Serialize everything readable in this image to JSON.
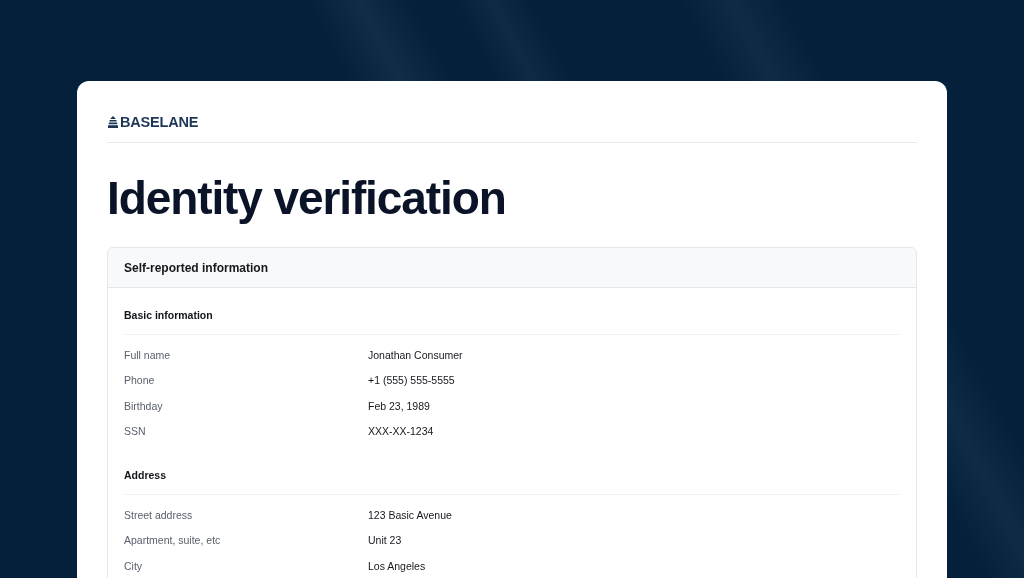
{
  "brand": {
    "name": "BASELANE"
  },
  "page": {
    "title": "Identity verification"
  },
  "panel": {
    "title": "Self-reported information",
    "sections": [
      {
        "title": "Basic information",
        "rows": [
          {
            "label": "Full name",
            "value": "Jonathan Consumer"
          },
          {
            "label": "Phone",
            "value": "+1 (555) 555-5555"
          },
          {
            "label": "Birthday",
            "value": "Feb 23, 1989"
          },
          {
            "label": "SSN",
            "value": "XXX-XX-1234"
          }
        ]
      },
      {
        "title": "Address",
        "rows": [
          {
            "label": "Street address",
            "value": "123 Basic Avenue"
          },
          {
            "label": "Apartment, suite, etc",
            "value": "Unit 23"
          },
          {
            "label": "City",
            "value": "Los Angeles"
          }
        ]
      }
    ]
  }
}
